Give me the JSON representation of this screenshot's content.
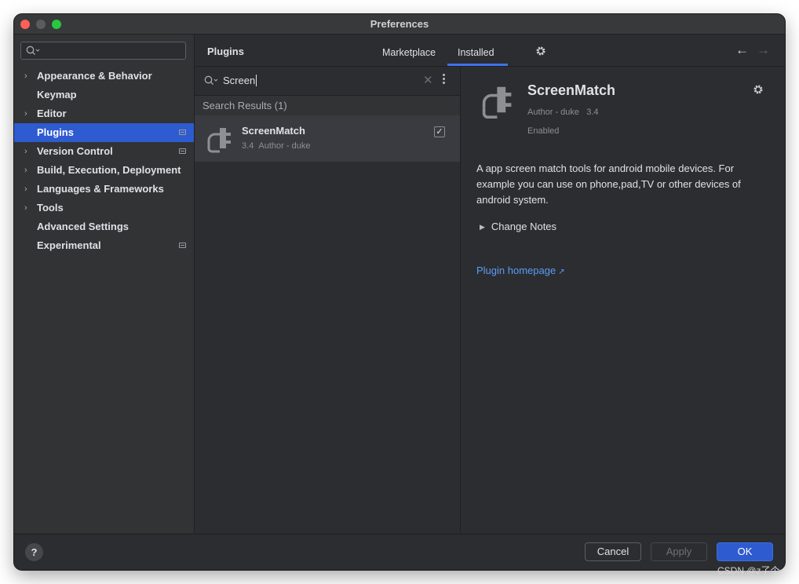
{
  "window": {
    "title": "Preferences"
  },
  "sidebar": {
    "search_placeholder": "",
    "items": [
      {
        "label": "Appearance & Behavior",
        "expandable": true,
        "badge": false
      },
      {
        "label": "Keymap",
        "expandable": false,
        "badge": false
      },
      {
        "label": "Editor",
        "expandable": true,
        "badge": false
      },
      {
        "label": "Plugins",
        "expandable": false,
        "badge": true,
        "selected": true
      },
      {
        "label": "Version Control",
        "expandable": true,
        "badge": true
      },
      {
        "label": "Build, Execution, Deployment",
        "expandable": true,
        "badge": false
      },
      {
        "label": "Languages & Frameworks",
        "expandable": true,
        "badge": false
      },
      {
        "label": "Tools",
        "expandable": true,
        "badge": false
      },
      {
        "label": "Advanced Settings",
        "expandable": false,
        "badge": false
      },
      {
        "label": "Experimental",
        "expandable": false,
        "badge": true
      }
    ]
  },
  "header": {
    "title": "Plugins",
    "tabs": [
      {
        "label": "Marketplace",
        "active": false
      },
      {
        "label": "Installed",
        "active": true
      }
    ],
    "icons": {
      "settings": "gear-icon",
      "back": "arrow-left-icon",
      "forward": "arrow-right-icon"
    }
  },
  "plugin_list": {
    "search_value": "Screen",
    "results_header": "Search Results (1)",
    "items": [
      {
        "name": "ScreenMatch",
        "version": "3.4",
        "author": "Author - duke",
        "checked": true
      }
    ]
  },
  "details": {
    "name": "ScreenMatch",
    "author": "Author - duke",
    "version": "3.4",
    "status": "Enabled",
    "description": "A app screen match tools for android mobile devices. For example you can use on phone,pad,TV or other devices of android system.",
    "change_notes_label": "Change Notes",
    "homepage_link": "Plugin homepage",
    "homepage_arrow": "↗"
  },
  "footer": {
    "help_label": "?",
    "cancel_label": "Cancel",
    "apply_label": "Apply",
    "ok_label": "OK"
  },
  "watermark": "CSDN @z了个",
  "colors": {
    "accent": "#2f5bd0",
    "link": "#5b9cf5",
    "background": "#2b2d30"
  }
}
